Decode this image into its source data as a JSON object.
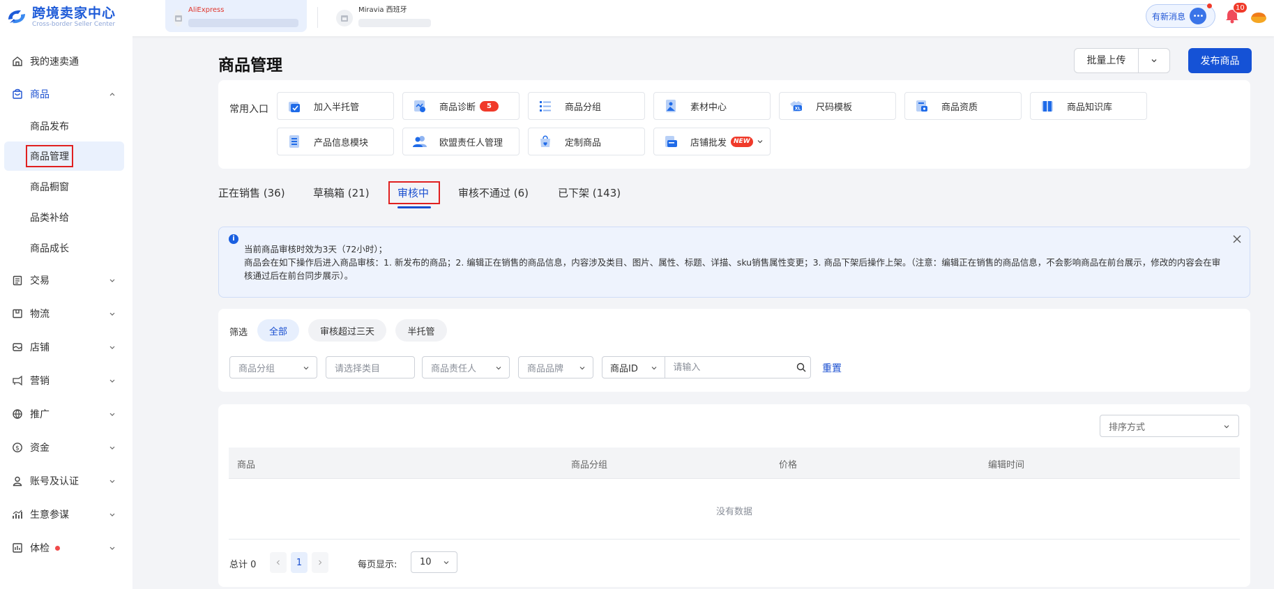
{
  "brand": {
    "title": "跨境卖家中心",
    "subtitle": "Cross-border Seller Center"
  },
  "stores": [
    {
      "name": "AliExpress"
    },
    {
      "name": "Miravia 西班牙"
    }
  ],
  "header": {
    "new_message": "有新消息",
    "notification_count": "10"
  },
  "sidebar": {
    "items": [
      {
        "label": "我的速卖通",
        "icon": "home-icon"
      },
      {
        "label": "商品",
        "icon": "bag-icon",
        "expanded": true
      },
      {
        "label": "交易",
        "icon": "clipboard-icon"
      },
      {
        "label": "物流",
        "icon": "box-icon"
      },
      {
        "label": "店铺",
        "icon": "store-icon"
      },
      {
        "label": "营销",
        "icon": "megaphone-icon"
      },
      {
        "label": "推广",
        "icon": "globe-icon"
      },
      {
        "label": "资金",
        "icon": "dollar-icon"
      },
      {
        "label": "账号及认证",
        "icon": "user-icon"
      },
      {
        "label": "生意参谋",
        "icon": "chart-icon"
      },
      {
        "label": "体检",
        "icon": "checkup-icon",
        "has_dot": true
      }
    ],
    "subitems": [
      {
        "label": "商品发布"
      },
      {
        "label": "商品管理",
        "active": true
      },
      {
        "label": "商品橱窗"
      },
      {
        "label": "品类补给"
      },
      {
        "label": "商品成长"
      }
    ]
  },
  "page": {
    "title": "商品管理",
    "batch_upload": "批量上传",
    "publish": "发布商品"
  },
  "entries": {
    "label": "常用入口",
    "items": [
      {
        "label": "加入半托管",
        "icon": "consign-icon"
      },
      {
        "label": "商品诊断",
        "icon": "diagnosis-icon",
        "badge": "5"
      },
      {
        "label": "商品分组",
        "icon": "list-icon"
      },
      {
        "label": "素材中心",
        "icon": "image-icon"
      },
      {
        "label": "尺码模板",
        "icon": "size-icon"
      },
      {
        "label": "商品资质",
        "icon": "certificate-icon"
      },
      {
        "label": "商品知识库",
        "icon": "book-icon"
      },
      {
        "label": "产品信息模块",
        "icon": "document-icon"
      },
      {
        "label": "欧盟责任人管理",
        "icon": "people-icon"
      },
      {
        "label": "定制商品",
        "icon": "custom-icon"
      },
      {
        "label": "店铺批发",
        "icon": "wholesale-icon",
        "badge_new": "NEW"
      }
    ]
  },
  "tabs": [
    {
      "label": "正在销售 (36)"
    },
    {
      "label": "草稿箱 (21)"
    },
    {
      "label": "审核中",
      "active": true
    },
    {
      "label": "审核不通过 (6)"
    },
    {
      "label": "已下架 (143)"
    }
  ],
  "notice": {
    "line1": "当前商品审核时效为3天（72小时）；",
    "line2": "商品会在如下操作后进入商品审核：1. 新发布的商品；2. 编辑正在销售的商品信息，内容涉及类目、图片、属性、标题、详描、sku销售属性变更；3. 商品下架后操作上架。（注意：编辑正在销售的商品信息，不会影响商品在前台展示，修改的内容会在审核通过后在前台同步展示）。"
  },
  "filter": {
    "label": "筛选",
    "chips": [
      "全部",
      "审核超过三天",
      "半托管"
    ],
    "selects": {
      "group": "商品分组",
      "category": "请选择类目",
      "owner": "商品责任人",
      "brand": "商品品牌"
    },
    "id_type": "商品ID",
    "search_placeholder": "请输入",
    "reset": "重置"
  },
  "table": {
    "sort": "排序方式",
    "columns": [
      "商品",
      "商品分组",
      "价格",
      "编辑时间"
    ],
    "empty": "没有数据",
    "total": "总计 0",
    "current_page": "1",
    "per_page_label": "每页显示:",
    "per_page": "10"
  },
  "colors": {
    "primary": "#1552d6",
    "danger": "#f03a2a",
    "highlight_box": "#e02020"
  }
}
